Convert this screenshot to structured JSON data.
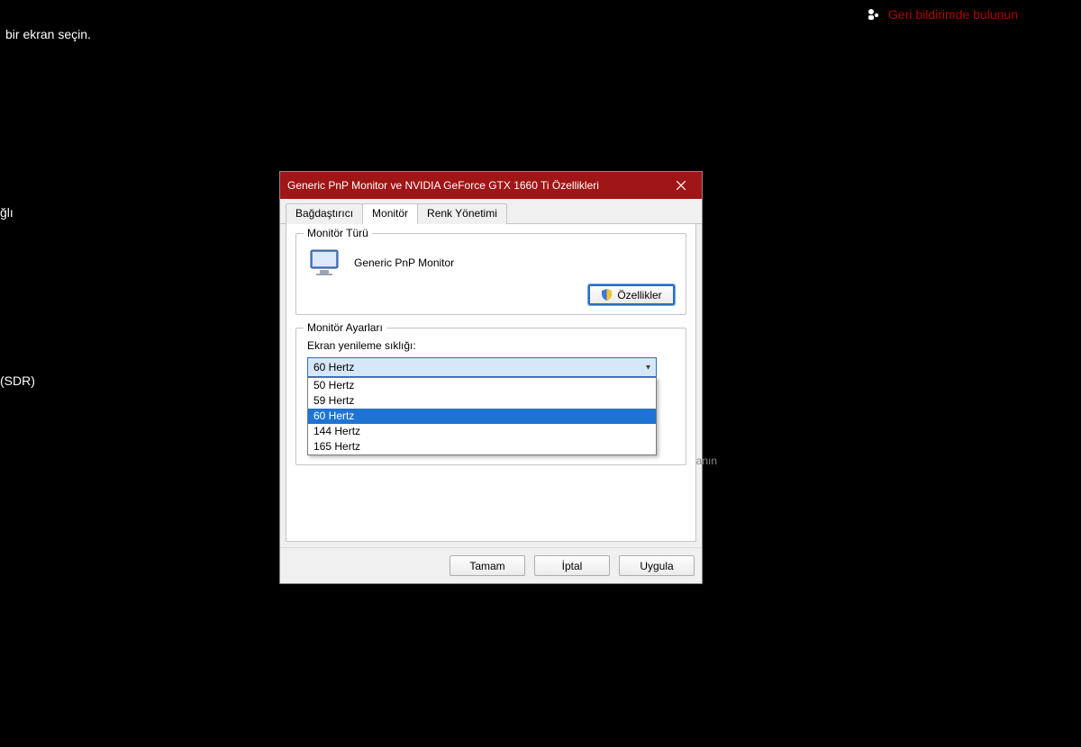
{
  "background": {
    "hint_top": "bir ekran seçin.",
    "hint_left_1": "ğlı",
    "hint_left_2": "(SDR)"
  },
  "feedback": {
    "label": "Geri bildirimde bulunun",
    "icon": "feedback-icon"
  },
  "dialog": {
    "title": "Generic PnP Monitor ve NVIDIA GeForce GTX 1660 Ti Özellikleri",
    "close_icon": "close-icon",
    "tabs": {
      "adapter": "Bağdaştırıcı",
      "monitor": "Monitör",
      "color": "Renk Yönetimi",
      "active": "monitor"
    },
    "group_monitor_type": {
      "legend": "Monitör Türü",
      "name": "Generic PnP Monitor",
      "properties_button": "Özellikler",
      "shield_icon": "shield-icon"
    },
    "group_monitor_settings": {
      "legend": "Monitör Ayarları",
      "refresh_label": "Ekran yenileme sıklığı:",
      "selected": "60 Hertz",
      "options": [
        "50 Hertz",
        "59 Hertz",
        "60 Hertz",
        "144 Hertz",
        "165 Hertz"
      ],
      "trailing_partial": "anın"
    },
    "buttons": {
      "ok": "Tamam",
      "cancel": "İptal",
      "apply": "Uygula"
    }
  }
}
